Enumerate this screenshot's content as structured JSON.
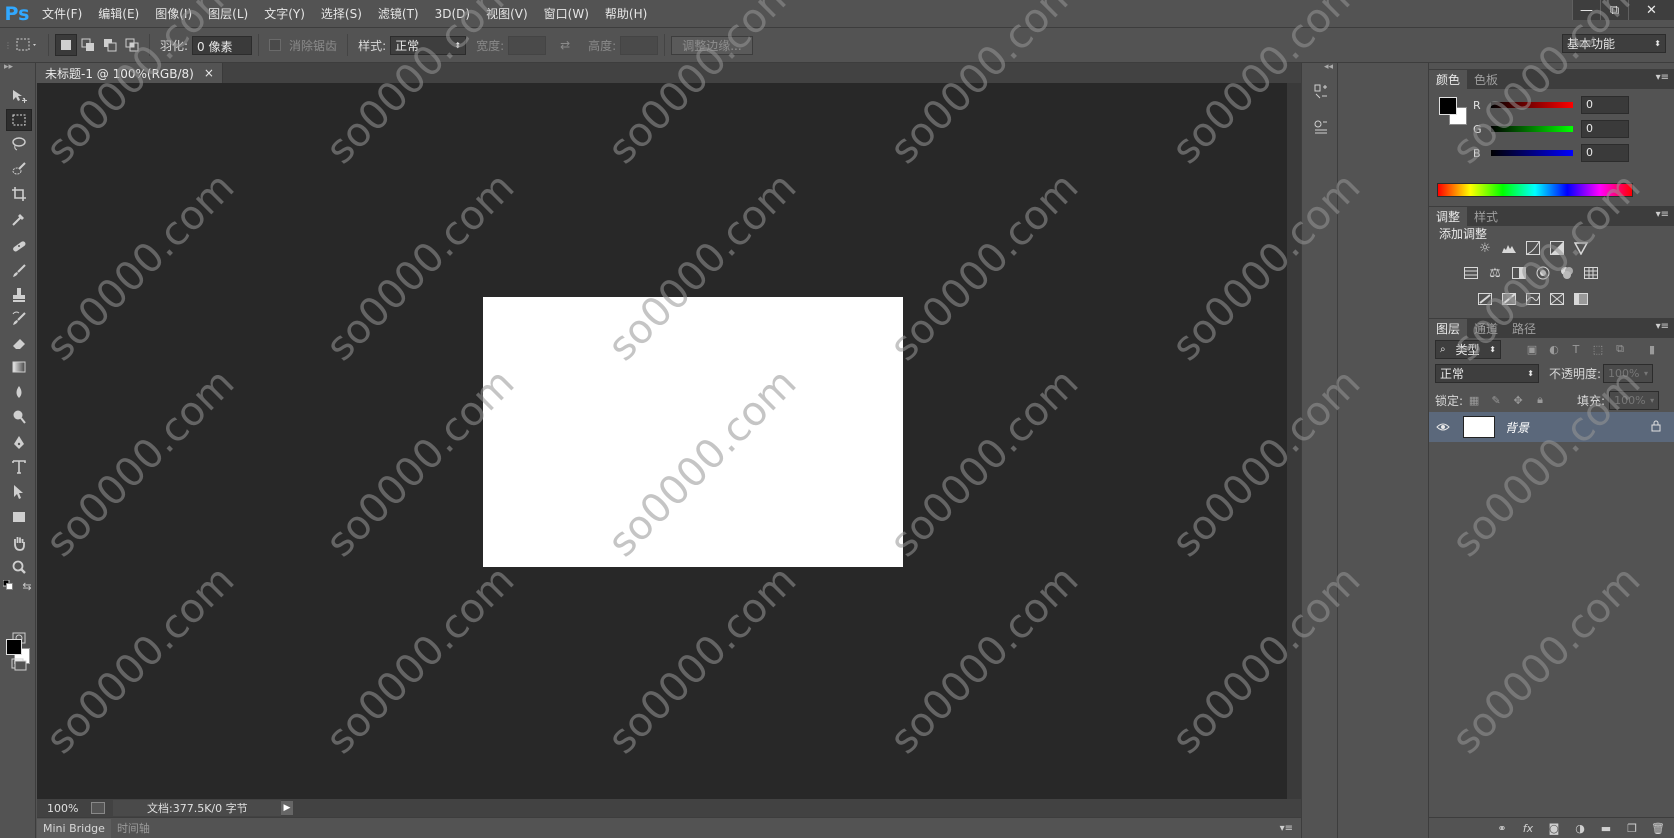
{
  "app": {
    "logo": "Ps"
  },
  "menu": [
    "文件(F)",
    "编辑(E)",
    "图像(I)",
    "图层(L)",
    "文字(Y)",
    "选择(S)",
    "滤镜(T)",
    "3D(D)",
    "视图(V)",
    "窗口(W)",
    "帮助(H)"
  ],
  "window_controls": {
    "minimize": "—",
    "restore": "⧉",
    "close": "✕"
  },
  "options": {
    "feather_label": "羽化:",
    "feather_value": "0 像素",
    "antialias_label": "消除锯齿",
    "style_label": "样式:",
    "style_value": "正常",
    "width_label": "宽度:",
    "height_label": "高度:",
    "refine_edge": "调整边缘...",
    "workspace": "基本功能"
  },
  "document": {
    "tab_title": "未标题-1 @ 100%(RGB/8)",
    "tab_close": "×",
    "zoom": "100%",
    "doc_info": "文档:377.5K/0 字节"
  },
  "bottom_tabs": [
    "Mini Bridge",
    "时间轴"
  ],
  "color_panel": {
    "tabs": [
      "颜色",
      "色板"
    ],
    "channels": [
      {
        "name": "R",
        "value": "0",
        "color": "#ff0000"
      },
      {
        "name": "G",
        "value": "0",
        "color": "#00ff00"
      },
      {
        "name": "B",
        "value": "0",
        "color": "#0000ff"
      }
    ],
    "foreground": "#000000",
    "background": "#ffffff"
  },
  "adjust_panel": {
    "tabs": [
      "调整",
      "样式"
    ],
    "title": "添加调整"
  },
  "layers_panel": {
    "tabs": [
      "图层",
      "通道",
      "路径"
    ],
    "filter_type": "类型",
    "blend_mode": "正常",
    "opacity_label": "不透明度:",
    "opacity_value": "100%",
    "lock_label": "锁定:",
    "fill_label": "填充:",
    "fill_value": "100%",
    "layers": [
      {
        "name": "背景",
        "visible": true,
        "locked": true
      }
    ]
  },
  "watermark": "so0000.com"
}
